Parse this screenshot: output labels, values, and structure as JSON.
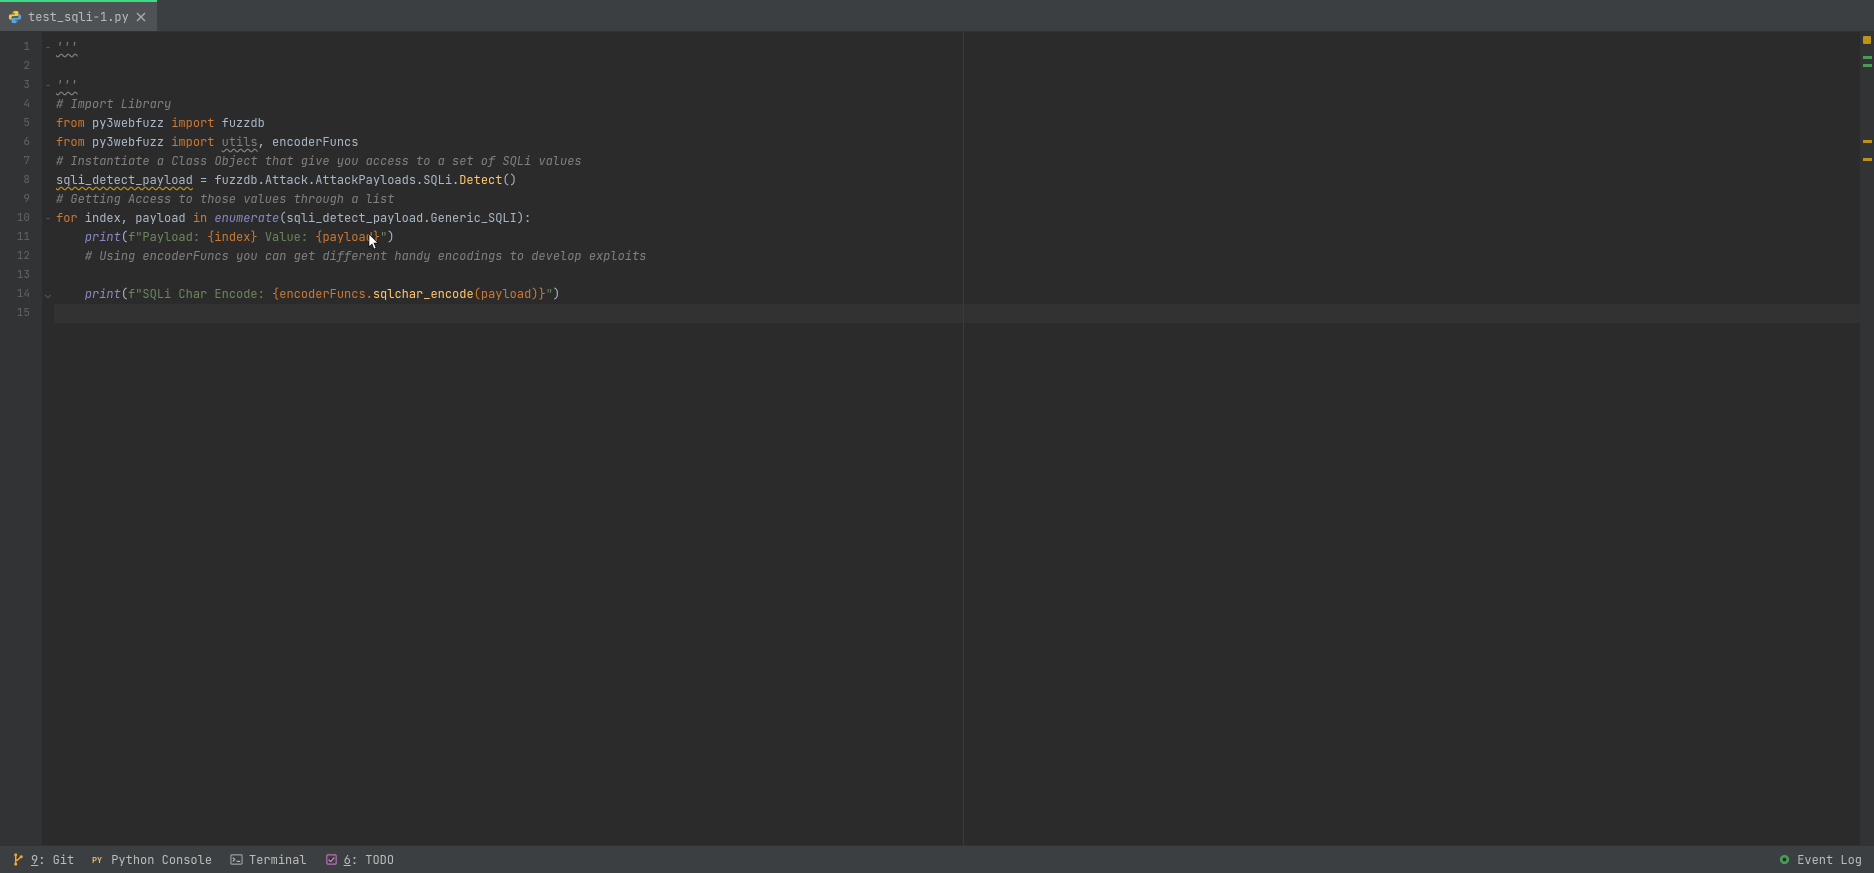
{
  "tab": {
    "filename": "test_sqli-1.py",
    "close_tooltip": "Close"
  },
  "gutter_lines": [
    "1",
    "2",
    "3",
    "4",
    "5",
    "6",
    "7",
    "8",
    "9",
    "10",
    "11",
    "12",
    "13",
    "14",
    "15"
  ],
  "code": {
    "l1": "'''",
    "l2": "",
    "l3": "'''",
    "l4": "# Import Library",
    "l5a": "from",
    "l5b": " py3webfuzz ",
    "l5c": "import",
    "l5d": " fuzzdb",
    "l6a": "from",
    "l6b": " py3webfuzz ",
    "l6c": "import",
    "l6d": " ",
    "l6e": "utils",
    "l6f": ", encoderFuncs",
    "l7": "# Instantiate a Class Object that give you access to a set of SQLi values",
    "l8a": "sqli_detect_payload",
    "l8b": " = fuzzdb.Attack.AttackPayloads.SQLi.",
    "l8c": "Detect",
    "l8d": "()",
    "l9": "# Getting Access to those values through a list",
    "l10a": "for",
    "l10b": " index, payload ",
    "l10c": "in",
    "l10d": " ",
    "l10e": "enumerate",
    "l10f": "(sqli_detect_payload.Generic_SQLI):",
    "l11a": "    ",
    "l11b": "print",
    "l11c": "(",
    "l11d": "f\"Payload: ",
    "l11e": "{index}",
    "l11f": " Value: ",
    "l11g": "{payload}",
    "l11h": "\"",
    "l11i": ")",
    "l12a": "    ",
    "l12b": "# Using encoderFuncs you can get different handy encodings to develop exploits",
    "l13": "",
    "l14a": "    ",
    "l14b": "print",
    "l14c": "(",
    "l14d": "f\"SQLi Char Encode: ",
    "l14e": "{encoderFuncs.",
    "l14f": "sqlchar_encode",
    "l14g": "(payload)}",
    "l14h": "\"",
    "l14i": ")",
    "l15": ""
  },
  "bottom": {
    "git_key": "9",
    "git_label": ": Git",
    "python_console": "Python Console",
    "terminal": "Terminal",
    "todo_key": "6",
    "todo_label": ": TODO",
    "event_log": "Event Log"
  }
}
